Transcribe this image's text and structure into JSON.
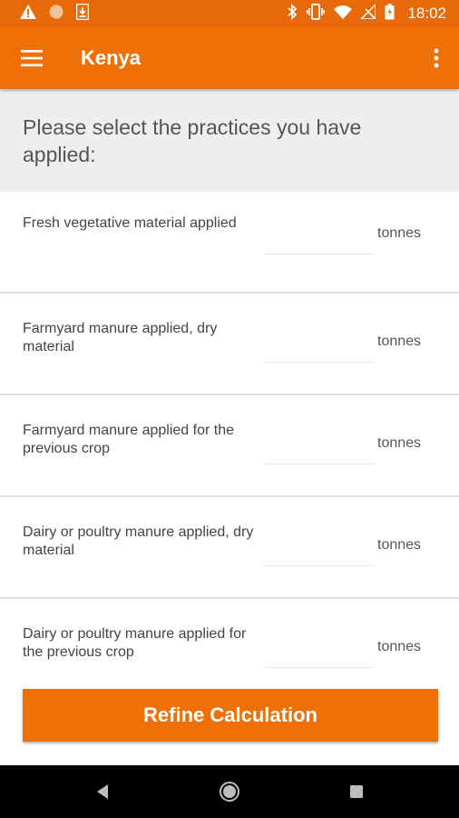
{
  "status_bar": {
    "time": "18:02",
    "left_icons": [
      "warning-icon",
      "circle-icon",
      "download-icon"
    ],
    "right_icons": [
      "bluetooth-icon",
      "vibrate-icon",
      "wifi-icon",
      "no-signal-icon",
      "battery-icon"
    ]
  },
  "app_bar": {
    "title": "Kenya",
    "menu_icon": "hamburger-menu-icon",
    "overflow_icon": "more-vert-icon"
  },
  "prompt": "Please select the practices you have applied:",
  "practices": [
    {
      "label": "Fresh vegetative material applied",
      "value": "",
      "unit": "tonnes"
    },
    {
      "label": "Farmyard manure applied, dry material",
      "value": "",
      "unit": "tonnes"
    },
    {
      "label": "Farmyard manure applied for the previous crop",
      "value": "",
      "unit": "tonnes"
    },
    {
      "label": "Dairy or poultry manure applied, dry material",
      "value": "",
      "unit": "tonnes"
    },
    {
      "label": "Dairy or poultry manure applied for the previous crop",
      "value": "",
      "unit": "tonnes"
    }
  ],
  "refine_button_label": "Refine Calculation",
  "colors": {
    "primary": "#ef7007",
    "status_bar": "#e8690a",
    "prompt_bg": "#eeeeee"
  },
  "nav_icons": [
    "back-icon",
    "home-icon",
    "recents-icon"
  ]
}
